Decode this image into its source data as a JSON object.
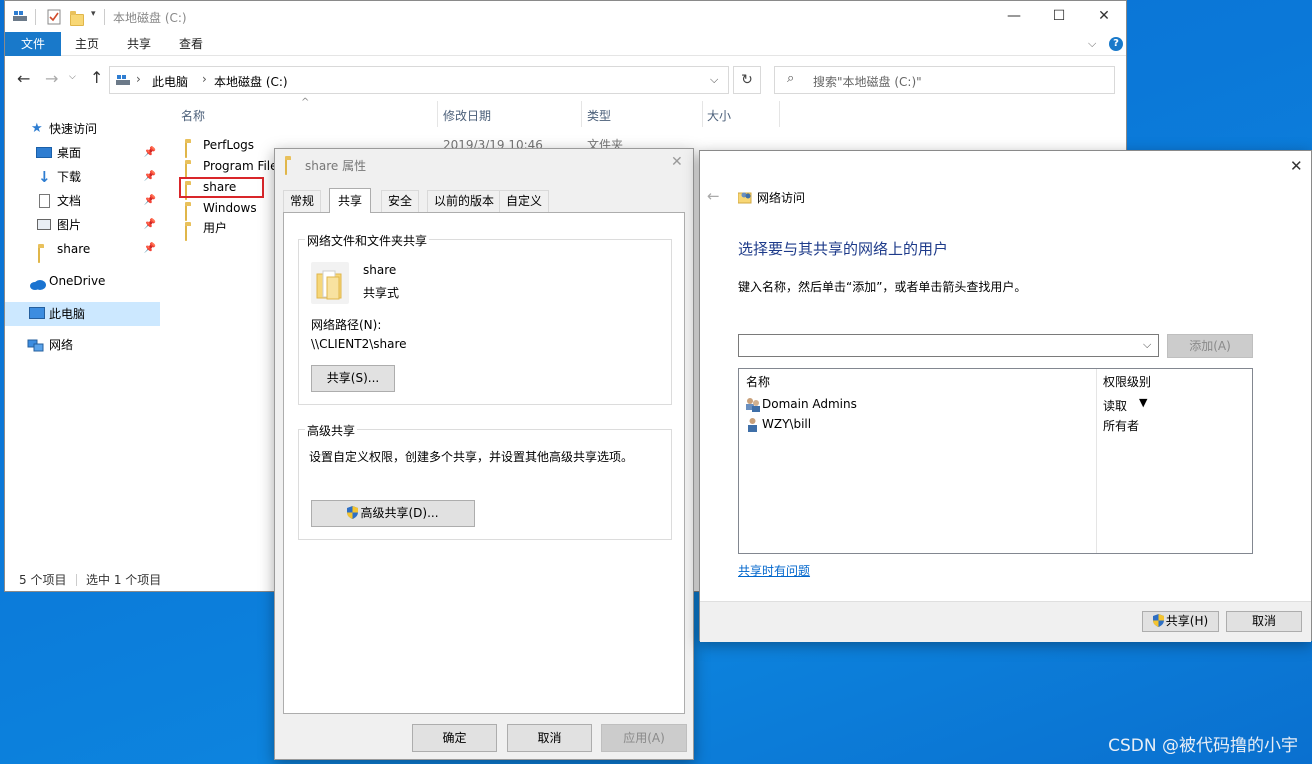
{
  "explorer": {
    "title": "本地磁盘 (C:)",
    "ribbon_tabs": [
      "文件",
      "主页",
      "共享",
      "查看"
    ],
    "breadcrumb": [
      "此电脑",
      "本地磁盘 (C:)"
    ],
    "search_placeholder": "搜索\"本地磁盘 (C:)\"",
    "columns": [
      "名称",
      "修改日期",
      "类型",
      "大小"
    ],
    "nav": {
      "quick_access": "快速访问",
      "items": [
        "桌面",
        "下载",
        "文档",
        "图片",
        "share"
      ],
      "onedrive": "OneDrive",
      "this_pc": "此电脑",
      "network": "网络"
    },
    "files": [
      "PerfLogs",
      "Program Files",
      "share",
      "Windows",
      "用户"
    ],
    "first_row": {
      "date": "2019/3/19 10:46",
      "type": "文件夹"
    },
    "status_count": "5 个项目",
    "status_selected": "选中 1 个项目"
  },
  "props": {
    "title": "share 属性",
    "tabs": [
      "常规",
      "共享",
      "安全",
      "以前的版本",
      "自定义"
    ],
    "group1_title": "网络文件和文件夹共享",
    "folder_name": "share",
    "folder_state": "共享式",
    "path_label": "网络路径(N):",
    "path_value": "\\\\CLIENT2\\share",
    "share_button": "共享(S)...",
    "group2_title": "高级共享",
    "adv_desc": "设置自定义权限，创建多个共享，并设置其他高级共享选项。",
    "adv_button": "高级共享(D)...",
    "ok": "确定",
    "cancel": "取消",
    "apply": "应用(A)"
  },
  "netaccess": {
    "title": "网络访问",
    "heading": "选择要与其共享的网络上的用户",
    "instruction": "键入名称，然后单击“添加”，或者单击箭头查找用户。",
    "add_button": "添加(A)",
    "col_name": "名称",
    "col_perm": "权限级别",
    "users": [
      {
        "name": "Domain Admins",
        "perm": "读取"
      },
      {
        "name": "WZY\\bill",
        "perm": "所有者"
      }
    ],
    "help_link": "共享时有问题",
    "share_button": "共享(H)",
    "cancel_button": "取消"
  },
  "watermark": "CSDN @被代码撸的小宇",
  "colors": {
    "accent": "#1979ca",
    "heading": "#1e3b8a",
    "desktop": "#0b78d8",
    "selection": "#cce8ff",
    "highlight_box": "#d9262a"
  }
}
